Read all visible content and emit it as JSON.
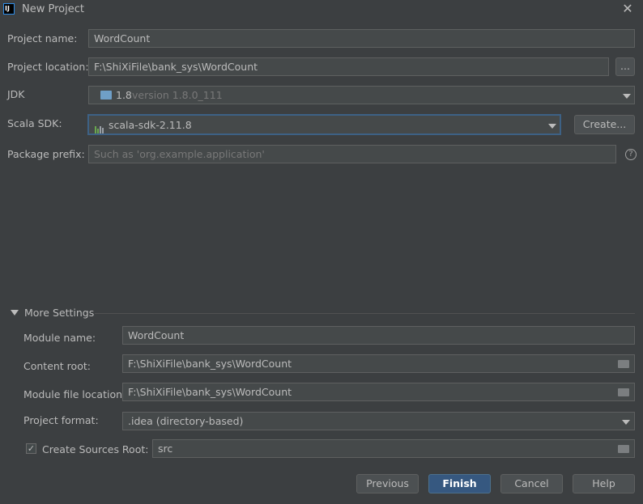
{
  "window": {
    "title": "New Project"
  },
  "project": {
    "name_label": "Project name:",
    "name_value": "WordCount",
    "location_label": "Project location:",
    "location_value": "F:\\ShiXiFile\\bank_sys\\WordCount",
    "browse_label": "...",
    "jdk_label": "JDK",
    "jdk_name": "1.8",
    "jdk_version": "version 1.8.0_111",
    "scala_label": "Scala SDK:",
    "scala_value": "scala-sdk-2.11.8",
    "create_label": "Create...",
    "package_label": "Package prefix:",
    "package_placeholder": "Such as 'org.example.application'"
  },
  "more_settings": {
    "header": "More Settings",
    "module_name_label": "Module name:",
    "module_name_value": "WordCount",
    "content_root_label": "Content root:",
    "content_root_value": "F:\\ShiXiFile\\bank_sys\\WordCount",
    "module_file_label": "Module file location:",
    "module_file_value": "F:\\ShiXiFile\\bank_sys\\WordCount",
    "format_label": "Project format:",
    "format_value": ".idea (directory-based)",
    "sources_root_label": "Create Sources Root:",
    "sources_root_value": "src",
    "sources_root_checked": true
  },
  "buttons": {
    "previous": "Previous",
    "finish": "Finish",
    "cancel": "Cancel",
    "help": "Help"
  },
  "icons": {
    "close": "close-icon",
    "folder": "folder-icon",
    "help": "help-icon",
    "dropdown": "chevron-down-icon"
  },
  "colors": {
    "background": "#3c3f41",
    "field": "#45494a",
    "focus_border": "#3d6185",
    "primary_button": "#365880"
  }
}
